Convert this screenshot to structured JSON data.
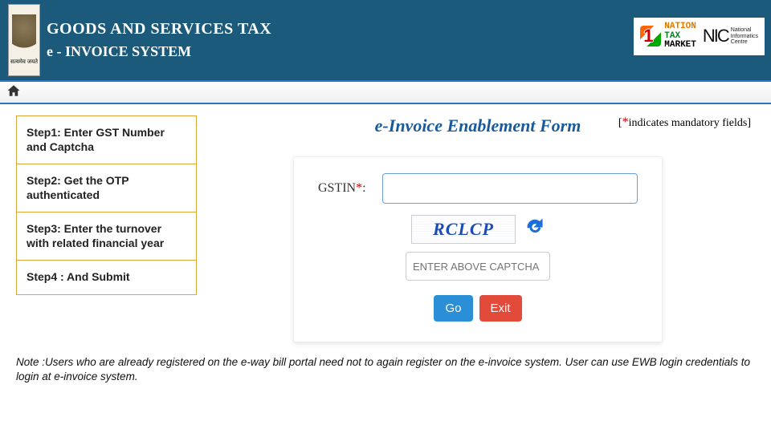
{
  "header": {
    "title_line1": "GOODS AND SERVICES TAX",
    "title_line2": "e - INVOICE SYSTEM",
    "emblem_label": "सत्यमेव जयते",
    "ntm": {
      "line1": "NATION",
      "line2": "TAX",
      "line3": "MARKET"
    },
    "nic": {
      "mark": "NIC",
      "line1": "National",
      "line2": "Informatics",
      "line3": "Centre"
    }
  },
  "sidebar_steps": [
    "Step1: Enter GST Number and Captcha",
    "Step2: Get the OTP authenticated",
    "Step3: Enter the turnover with related financial year",
    "Step4 : And Submit"
  ],
  "form": {
    "title": "e-Invoice Enablement Form",
    "mandatory_note_prefix": "[",
    "mandatory_note_star": "*",
    "mandatory_note_suffix": "indicates mandatory fields]",
    "gstin_label": "GSTIN",
    "gstin_required_mark": "*",
    "gstin_colon": ":",
    "gstin_value": "",
    "captcha_text": "RCLCP",
    "captcha_placeholder": "ENTER ABOVE CAPTCHA",
    "captcha_value": "",
    "go_label": "Go",
    "exit_label": "Exit"
  },
  "note": {
    "label": "Note  :",
    "text": "Users who are already registered on the e-way bill portal need not to again register on the e-invoice system. User can use EWB login credentials to login at e-invoice system."
  }
}
